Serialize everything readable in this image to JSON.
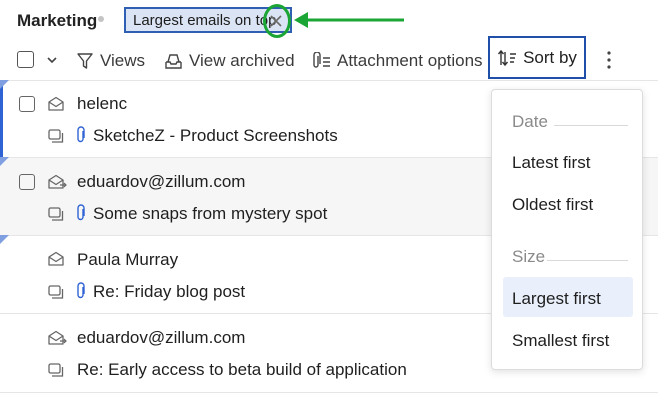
{
  "header": {
    "folder_title": "Marketing",
    "filter_chip": {
      "label": "Largest emails on top"
    }
  },
  "toolbar": {
    "views_label": "Views",
    "view_archived_label": "View archived",
    "attachment_options_label": "Attachment options",
    "sort_by_label": "Sort by"
  },
  "emails": [
    {
      "sender": "helenc",
      "subject": "SketcheZ - Product Screenshots",
      "has_attachment": true
    },
    {
      "sender": "eduardov@zillum.com",
      "subject": "Some snaps from mystery spot",
      "has_attachment": true
    },
    {
      "sender": "Paula Murray",
      "subject": "Re: Friday blog post",
      "has_attachment": true
    },
    {
      "sender": "eduardov@zillum.com",
      "subject": "Re: Early access to beta build of application",
      "has_attachment": false
    }
  ],
  "sort_menu": {
    "date_header": "Date",
    "latest_first": "Latest first",
    "oldest_first": "Oldest first",
    "size_header": "Size",
    "largest_first": "Largest first",
    "smallest_first": "Smallest first",
    "selected": "Largest first"
  },
  "colors": {
    "accent": "#2f5fb2",
    "annotation_green": "#1aa534",
    "selected_item_bg": "#eaf0fb"
  }
}
